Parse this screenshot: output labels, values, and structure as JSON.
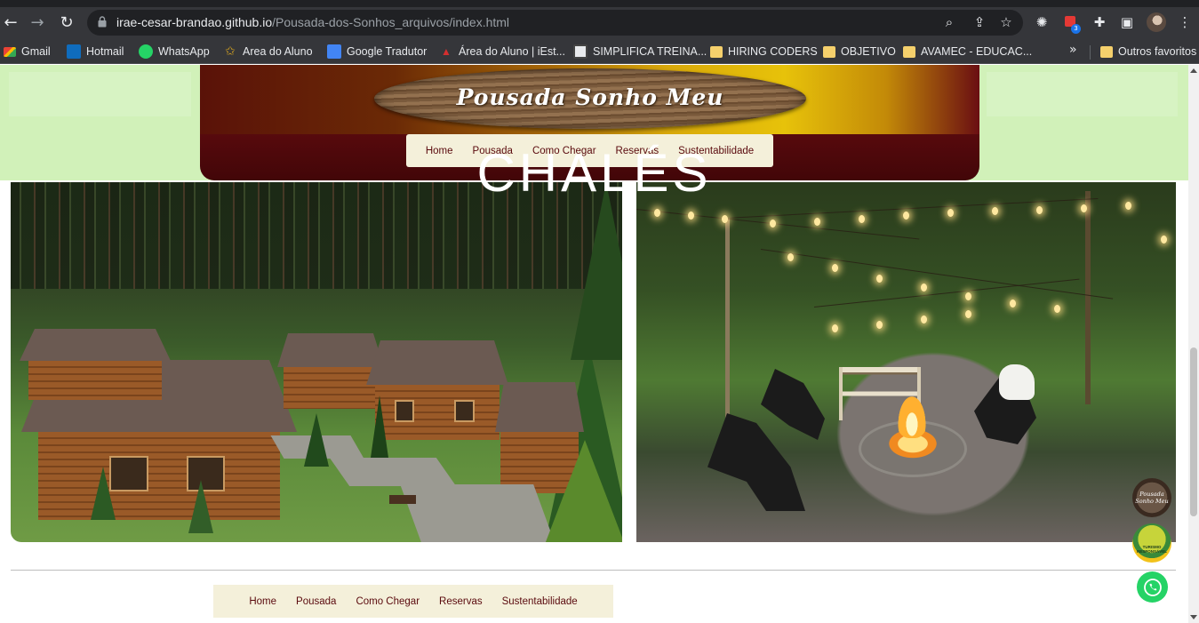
{
  "browser": {
    "url_host": "irae-cesar-brandao.github.io",
    "url_path": "/Pousada-dos-Sonhos_arquivos/index.html",
    "extension_badge_count": "3",
    "icons": {
      "back": "arrow-left-icon",
      "forward": "arrow-right-icon",
      "reload": "reload-icon",
      "lock": "lock-icon",
      "zoom": "zoom-icon",
      "share": "share-icon",
      "bookmark": "star-icon",
      "extensions": "puzzle-icon",
      "sidepanel": "side-panel-icon",
      "menu": "kebab-menu-icon"
    },
    "bookmarks": [
      {
        "label": "Gmail",
        "icon": "gmail-icon",
        "color": "#ea4335"
      },
      {
        "label": "Hotmail",
        "icon": "outlook-icon",
        "color": "#0f6cbd"
      },
      {
        "label": "WhatsApp",
        "icon": "whatsapp-icon",
        "color": "#25d366"
      },
      {
        "label": "Area do Aluno",
        "icon": "star-outline-icon",
        "color": "#d8a520"
      },
      {
        "label": "Google Tradutor",
        "icon": "google-translate-icon",
        "color": "#4285f4"
      },
      {
        "label": "Área do Aluno | iEst...",
        "icon": "bookmark-icon",
        "color": "#d32f2f"
      },
      {
        "label": "SIMPLIFICA TREINA...",
        "icon": "simplifica-icon",
        "color": "#e8eaed"
      },
      {
        "label": "HIRING CODERS",
        "icon": "folder-icon",
        "color": "#f5d06c"
      },
      {
        "label": "OBJETIVO",
        "icon": "folder-icon",
        "color": "#f5d06c"
      },
      {
        "label": "AVAMEC - EDUCAC...",
        "icon": "folder-icon",
        "color": "#f5d06c"
      }
    ],
    "more_bookmarks": "»",
    "other_bookmarks": "Outros favoritos"
  },
  "site": {
    "logo_text": "Pousada Sonho Meu",
    "section_title": "CHALÉS",
    "top_nav": [
      "Home",
      "Pousada",
      "Como Chegar",
      "Reservas",
      "Sustentabilidade"
    ],
    "bottom_nav": [
      "Home",
      "Pousada",
      "Como Chegar",
      "Reservas",
      "Sustentabilidade"
    ],
    "photos": [
      {
        "name": "cabins-photo",
        "subject": "wooden chalets on a lawn"
      },
      {
        "name": "firepit-photo",
        "subject": "fire pit patio with string lights"
      }
    ],
    "float_logo_text": "Pousada Sonho Meu",
    "float_turismo_text": "TURISMO RESPONSÁVEL",
    "colors": {
      "header": "#5a0a0e",
      "nav_bg": "#f4f0da",
      "nav_text": "#5a0a0e",
      "green_band": "#cdf0b4",
      "whatsapp": "#25d366"
    }
  }
}
